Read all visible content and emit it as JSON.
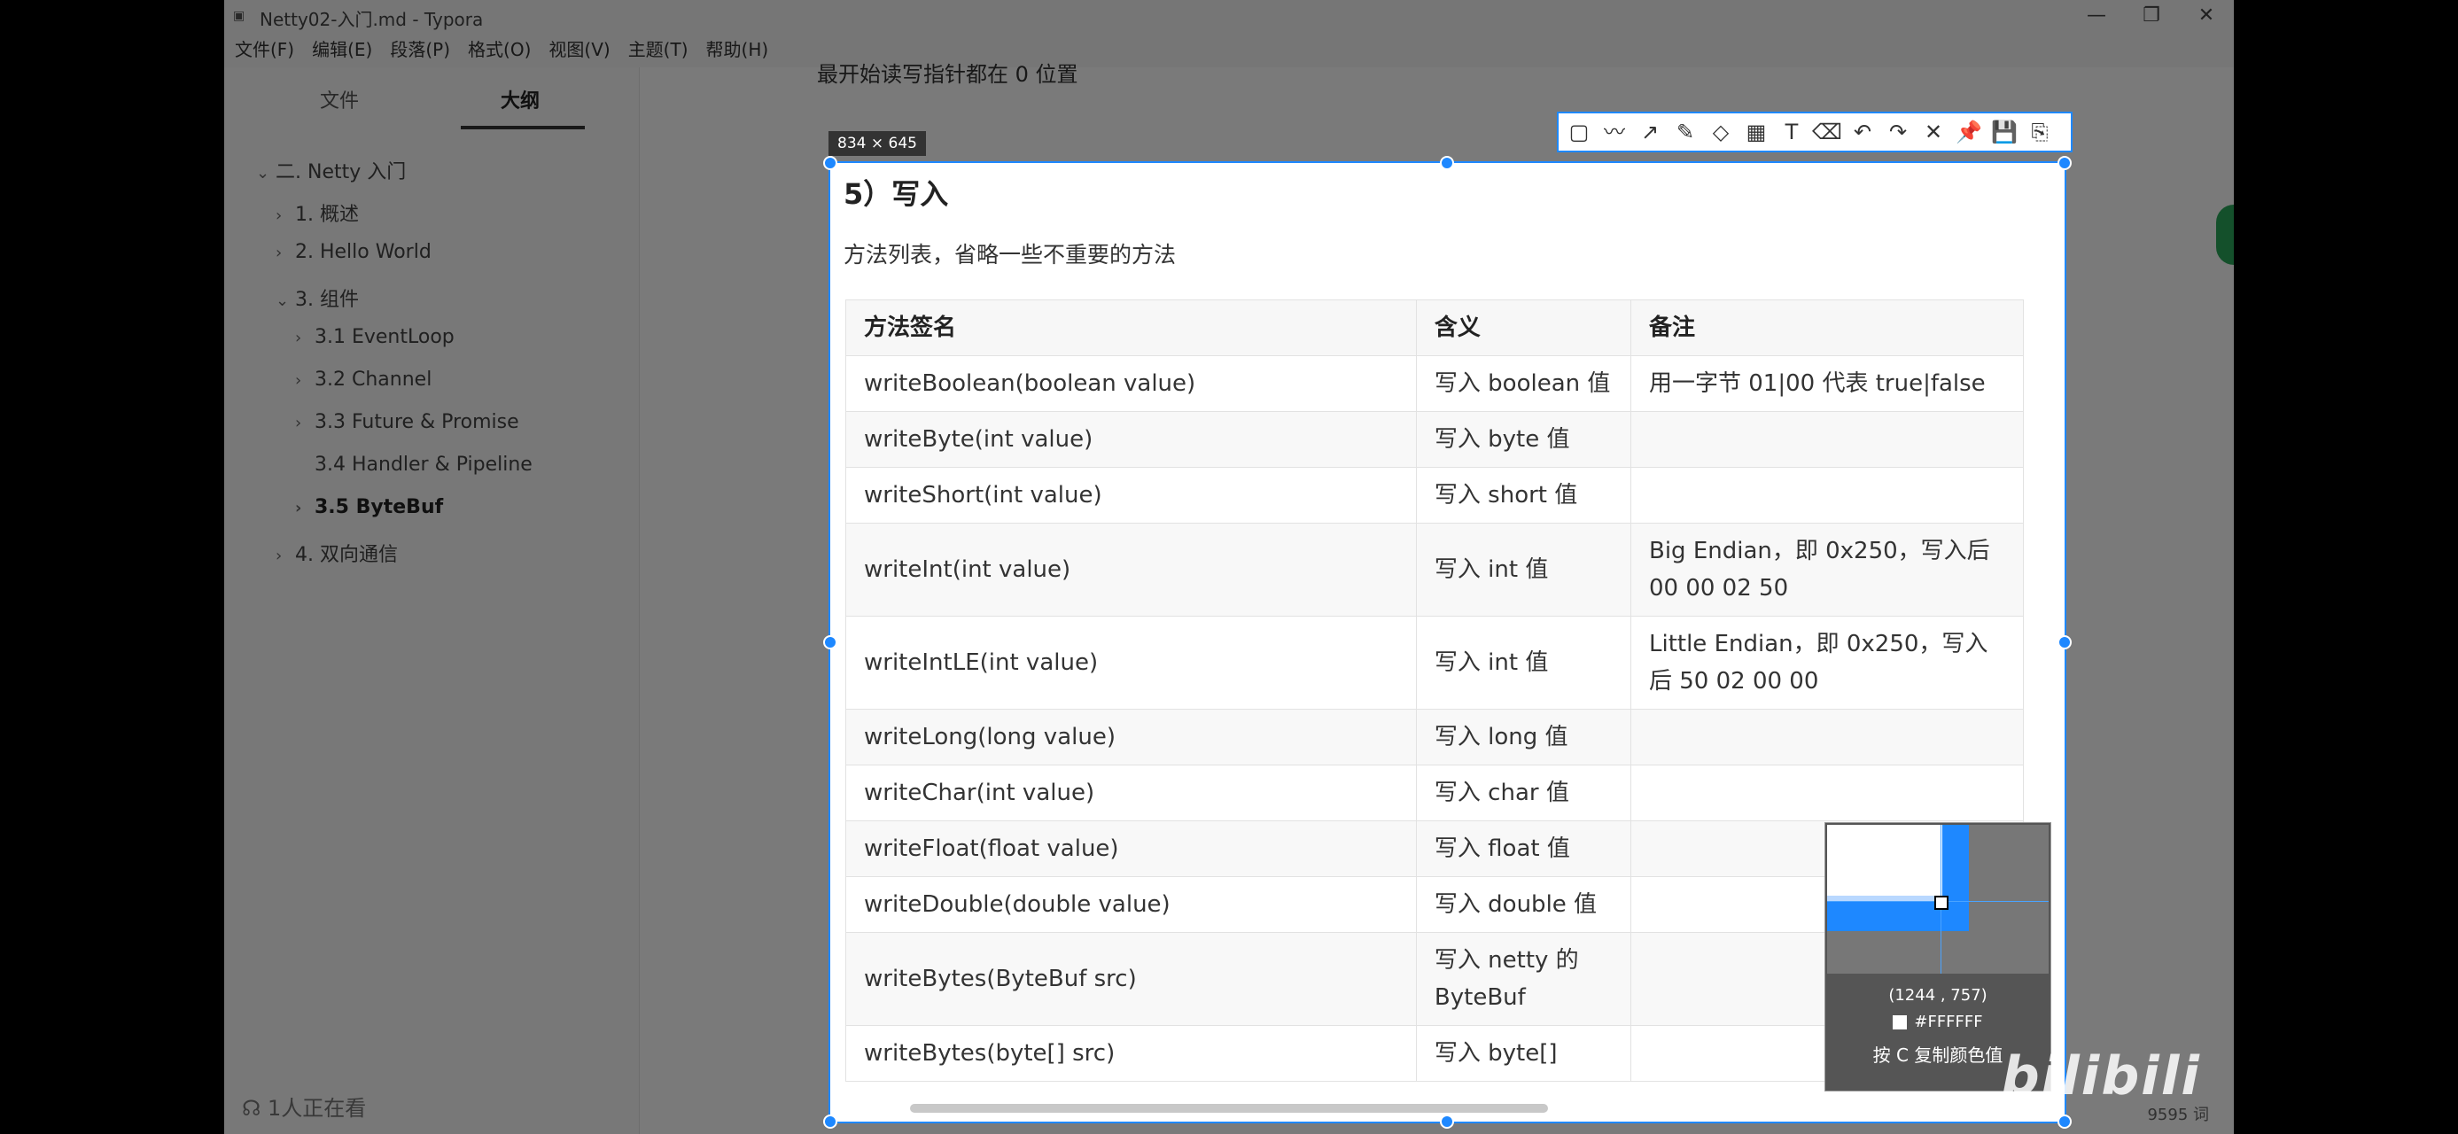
{
  "window": {
    "title": "Netty02-入门.md - Typora",
    "controls": {
      "minimize": "—",
      "maximize": "❐",
      "close": "✕"
    }
  },
  "menu": [
    "文件(F)",
    "编辑(E)",
    "段落(P)",
    "格式(O)",
    "视图(V)",
    "主题(T)",
    "帮助(H)"
  ],
  "sidebar": {
    "tabs": [
      "文件",
      "大纲"
    ],
    "active_tab": "大纲",
    "outline": [
      {
        "label": "二. Netty 入门",
        "chevron": "⌄"
      },
      {
        "label": "1. 概述",
        "chevron": "›"
      },
      {
        "label": "2. Hello World",
        "chevron": "›"
      },
      {
        "label": "3. 组件",
        "chevron": "⌄"
      },
      {
        "label": "3.1 EventLoop",
        "chevron": "›"
      },
      {
        "label": "3.2 Channel",
        "chevron": "›"
      },
      {
        "label": "3.3 Future & Promise",
        "chevron": "›"
      },
      {
        "label": "3.4 Handler & Pipeline",
        "chevron": ""
      },
      {
        "label": "3.5 ByteBuf",
        "chevron": "›"
      },
      {
        "label": "4. 双向通信",
        "chevron": "›"
      }
    ],
    "watchers": "1人正在看",
    "footer_icons": {
      "back": "‹",
      "source": "</>"
    }
  },
  "editor": {
    "top_line": "最开始读写指针都在 0 位置",
    "word_count": "9595 词"
  },
  "screenshot_tool": {
    "size_label": "834 × 645",
    "toolbar": [
      "▢",
      "〰",
      "↗",
      "✎",
      "◇",
      "▦",
      "T",
      "⌫",
      "↶",
      "↷",
      "✕",
      "📌",
      "💾",
      "⎘"
    ]
  },
  "content": {
    "heading": "5）写入",
    "description": "方法列表，省略一些不重要的方法",
    "table": {
      "headers": [
        "方法签名",
        "含义",
        "备注"
      ],
      "rows": [
        [
          "writeBoolean(boolean value)",
          "写入 boolean 值",
          "用一字节 01|00 代表 true|false"
        ],
        [
          "writeByte(int value)",
          "写入 byte 值",
          ""
        ],
        [
          "writeShort(int value)",
          "写入 short 值",
          ""
        ],
        [
          "writeInt(int value)",
          "写入 int 值",
          "Big Endian，即 0x250，写入后 00 00 02 50"
        ],
        [
          "writeIntLE(int value)",
          "写入 int 值",
          "Little Endian，即 0x250，写入后 50 02 00 00"
        ],
        [
          "writeLong(long value)",
          "写入 long 值",
          ""
        ],
        [
          "writeChar(int value)",
          "写入 char 值",
          ""
        ],
        [
          "writeFloat(float value)",
          "写入 float 值",
          ""
        ],
        [
          "writeDouble(double value)",
          "写入 double 值",
          ""
        ],
        [
          "writeBytes(ByteBuf src)",
          "写入 netty 的 ByteBuf",
          ""
        ],
        [
          "writeBytes(byte[] src)",
          "写入 byte[]",
          ""
        ]
      ]
    }
  },
  "magnifier": {
    "coords": "(1244 , 757)",
    "color": "#FFFFFF",
    "hint": "按 C 复制颜色值"
  },
  "watermark": "bilibili",
  "colors": {
    "accent": "#1e88ff",
    "dim_overlay": "rgba(0,0,0,0.52)"
  }
}
